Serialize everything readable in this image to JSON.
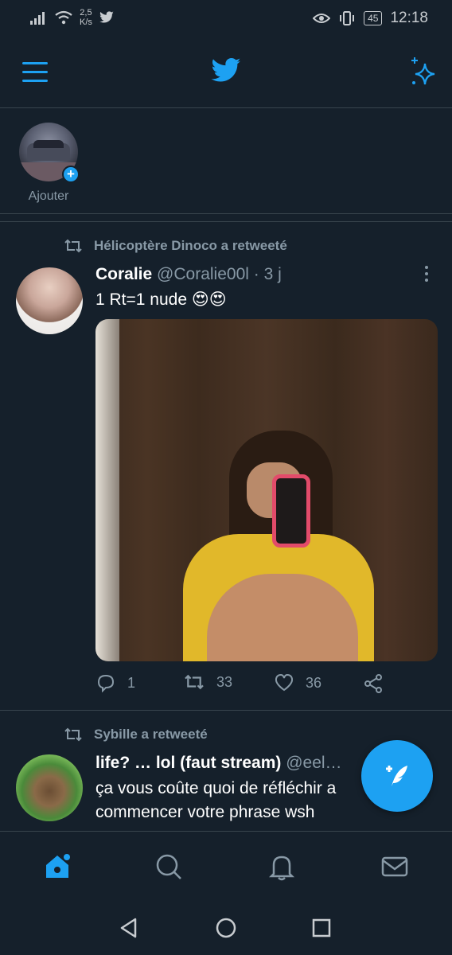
{
  "status_bar": {
    "speed_value": "2,5",
    "speed_unit": "K/s",
    "battery": "45",
    "time": "12:18"
  },
  "header": {
    "menu_icon": "hamburger-menu-icon",
    "logo_icon": "twitter-bird-icon",
    "sparkle_icon": "sparkle-icon"
  },
  "fleets": {
    "add_label": "Ajouter"
  },
  "tweets": [
    {
      "retweeted_by": "Hélicoptère Dinoco a retweeté",
      "name": "Coralie",
      "handle": "@Coralie00l · 3 j",
      "text": "1 Rt=1 nude 😍😍",
      "replies": "1",
      "retweets": "33",
      "likes": "36"
    },
    {
      "retweeted_by": "Sybille a retweeté",
      "name": "life? … lol (faut stream)",
      "handle": "@eel…",
      "text_line1": "ça vous coûte quoi de réfléchir a",
      "text_line2": "commencer votre phrase wsh"
    }
  ],
  "colors": {
    "background": "#15202b",
    "accent": "#1da1f2",
    "secondary_text": "#8899a6",
    "divider": "#38444d"
  }
}
